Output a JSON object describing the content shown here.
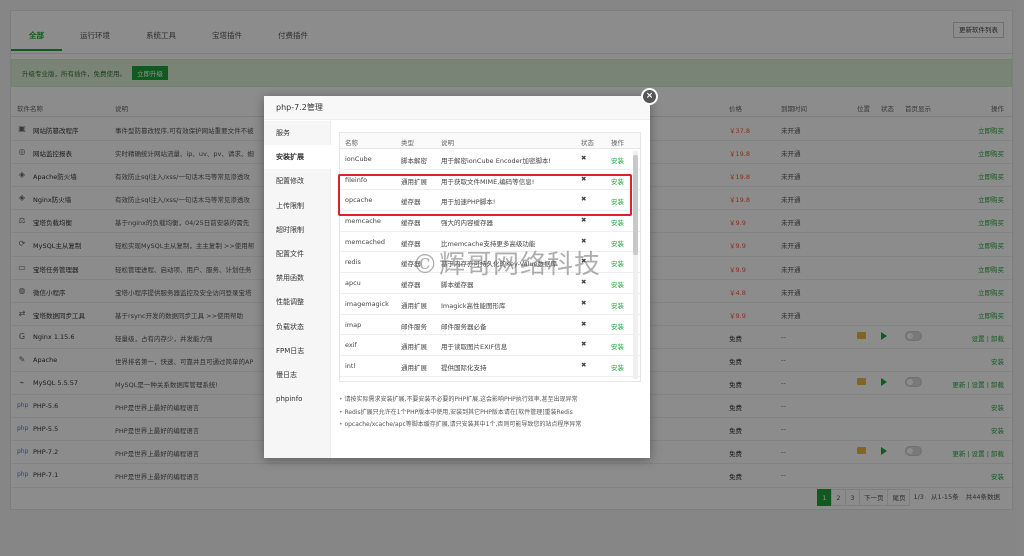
{
  "tabs": [
    "全部",
    "运行环境",
    "系统工具",
    "宝塔插件",
    "付费插件"
  ],
  "update_btn": "更新软件列表",
  "promo": {
    "text": "升级专业版，所有插件，免费使用。",
    "btn": "立即升级"
  },
  "table_head": {
    "name": "软件名称",
    "desc": "说明",
    "price": "价格",
    "expire": "到期时间",
    "pos": "位置",
    "status": "状态",
    "home": "首页显示",
    "op": "操作"
  },
  "rows": [
    {
      "icon": "▣",
      "name": "网站防篡改程序",
      "desc": "事件型防篡改程序,可有效保护网站重要文件不被",
      "price": "￥37.8",
      "expire": "未开通",
      "op": "立即购买"
    },
    {
      "icon": "◎",
      "name": "网站监控报表",
      "desc": "实时精确统计网站流量、ip、uv、pv、请求、蜘",
      "price": "￥19.8",
      "expire": "未开通",
      "op": "立即购买"
    },
    {
      "icon": "◈",
      "name": "Apache防火墙",
      "desc": "有效防止sql注入/xss/一句话木马等常见渗透攻",
      "price": "￥19.8",
      "expire": "未开通",
      "op": "立即购买"
    },
    {
      "icon": "◈",
      "name": "Nginx防火墙",
      "desc": "有效防止sql注入/xss/一句话木马等常见渗透攻",
      "price": "￥19.8",
      "expire": "未开通",
      "op": "立即购买"
    },
    {
      "icon": "⚖",
      "name": "宝塔负载均衡",
      "desc": "基于nginx的负载均衡，04/25日前安装的需先",
      "price": "￥9.9",
      "expire": "未开通",
      "op": "立即购买"
    },
    {
      "icon": "⟳",
      "name": "MySQL主从复制",
      "desc": "轻松实现MySQL主从复制，主主复制 >>使用帮",
      "price": "￥9.9",
      "expire": "未开通",
      "op": "立即购买"
    },
    {
      "icon": "▭",
      "name": "宝塔任务管理器",
      "desc": "轻松管理进程、启动项、用户、服务、计划任务",
      "price": "￥9.9",
      "expire": "未开通",
      "op": "立即购买"
    },
    {
      "icon": "◍",
      "name": "微信小程序",
      "desc": "宝塔小程序提供服务器监控及安全访问登录宝塔",
      "price": "￥4.8",
      "expire": "未开通",
      "op": "立即购买"
    },
    {
      "icon": "⇄",
      "name": "宝塔数据同步工具",
      "desc": "基于rsync开发的数据同步工具 >>使用帮助",
      "price": "￥9.9",
      "expire": "未开通",
      "op": "立即购买"
    },
    {
      "icon": "G",
      "name": "Nginx 1.15.6",
      "desc": "轻量级，占有内存少，并发能力强",
      "price": "免费",
      "expire": "--",
      "op": "设置 | 卸载",
      "controls": true
    },
    {
      "icon": "✎",
      "name": "Apache",
      "desc": "世界排名第一，快速、可靠并且可通过简单的AP",
      "price": "免费",
      "expire": "--",
      "op": "安装"
    },
    {
      "icon": "⌁",
      "name": "MySQL 5.5.57",
      "desc": "MySQL是一种关系数据库管理系统!",
      "price": "免费",
      "expire": "--",
      "op": "更新 | 设置 | 卸载",
      "controls": true
    },
    {
      "icon": "php",
      "name": "PHP-5.6",
      "desc": "PHP是世界上最好的编程语言",
      "price": "免费",
      "expire": "--",
      "op": "安装"
    },
    {
      "icon": "php",
      "name": "PHP-5.5",
      "desc": "PHP是世界上最好的编程语言",
      "price": "免费",
      "expire": "--",
      "op": "安装"
    },
    {
      "icon": "php",
      "name": "PHP-7.2",
      "desc": "PHP是世界上最好的编程语言",
      "price": "免费",
      "expire": "--",
      "op": "更新 | 设置 | 卸载",
      "controls": true
    },
    {
      "icon": "php",
      "name": "PHP-7.1",
      "desc": "PHP是世界上最好的编程语言",
      "price": "免费",
      "expire": "--",
      "op": "安装"
    }
  ],
  "pager": {
    "pages": [
      "1",
      "2",
      "3"
    ],
    "next": "下一页",
    "last": "尾页",
    "current": "1/3",
    "range": "从1-15条",
    "total": "共44条数据"
  },
  "dialog": {
    "title": "php-7.2管理",
    "close": "×",
    "side": [
      "服务",
      "安装扩展",
      "配置修改",
      "上传限制",
      "超时限制",
      "配置文件",
      "禁用函数",
      "性能调整",
      "负载状态",
      "FPM日志",
      "慢日志",
      "phpinfo"
    ],
    "active_side": 1,
    "ext_head": {
      "name": "名称",
      "type": "类型",
      "desc": "说明",
      "status": "状态",
      "op": "操作"
    },
    "extensions": [
      {
        "name": "ionCube",
        "type": "脚本解密",
        "desc": "用于解密ionCube Encoder加密脚本!",
        "status": "✖",
        "op": "安装"
      },
      {
        "name": "fileinfo",
        "type": "通用扩展",
        "desc": "用于获取文件MIME,编码等信息!",
        "status": "✖",
        "op": "安装"
      },
      {
        "name": "opcache",
        "type": "缓存器",
        "desc": "用于加速PHP脚本!",
        "status": "✖",
        "op": "安装"
      },
      {
        "name": "memcache",
        "type": "缓存器",
        "desc": "强大的内容缓存器",
        "status": "✖",
        "op": "安装"
      },
      {
        "name": "memcached",
        "type": "缓存器",
        "desc": "比memcache支持更多高级功能",
        "status": "✖",
        "op": "安装"
      },
      {
        "name": "redis",
        "type": "缓存器",
        "desc": "基于内存亦可持久化的Key-Value数据库",
        "status": "✖",
        "op": "安装"
      },
      {
        "name": "apcu",
        "type": "缓存器",
        "desc": "脚本缓存器",
        "status": "✖",
        "op": "安装"
      },
      {
        "name": "imagemagick",
        "type": "通用扩展",
        "desc": "Imagick高性能图形库",
        "status": "✖",
        "op": "安装"
      },
      {
        "name": "imap",
        "type": "邮件服务",
        "desc": "邮件服务器必备",
        "status": "✖",
        "op": "安装"
      },
      {
        "name": "exif",
        "type": "通用扩展",
        "desc": "用于读取图片EXIF信息",
        "status": "✖",
        "op": "安装"
      },
      {
        "name": "intl",
        "type": "通用扩展",
        "desc": "提供国际化支持",
        "status": "✖",
        "op": "安装"
      }
    ],
    "notes": [
      "请按实际需求安装扩展,不要安装不必要的PHP扩展,这会影响PHP执行效率,甚至出现异常",
      "Redis扩展只允许在1个PHP版本中使用,安装到其它PHP版本请在[软件管理]重装Redis",
      "opcache/xcache/apc等脚本缓存扩展,请只安装其中1个,否则可能导致您的站点程序异常"
    ]
  },
  "watermark": "©辉哥网络科技"
}
